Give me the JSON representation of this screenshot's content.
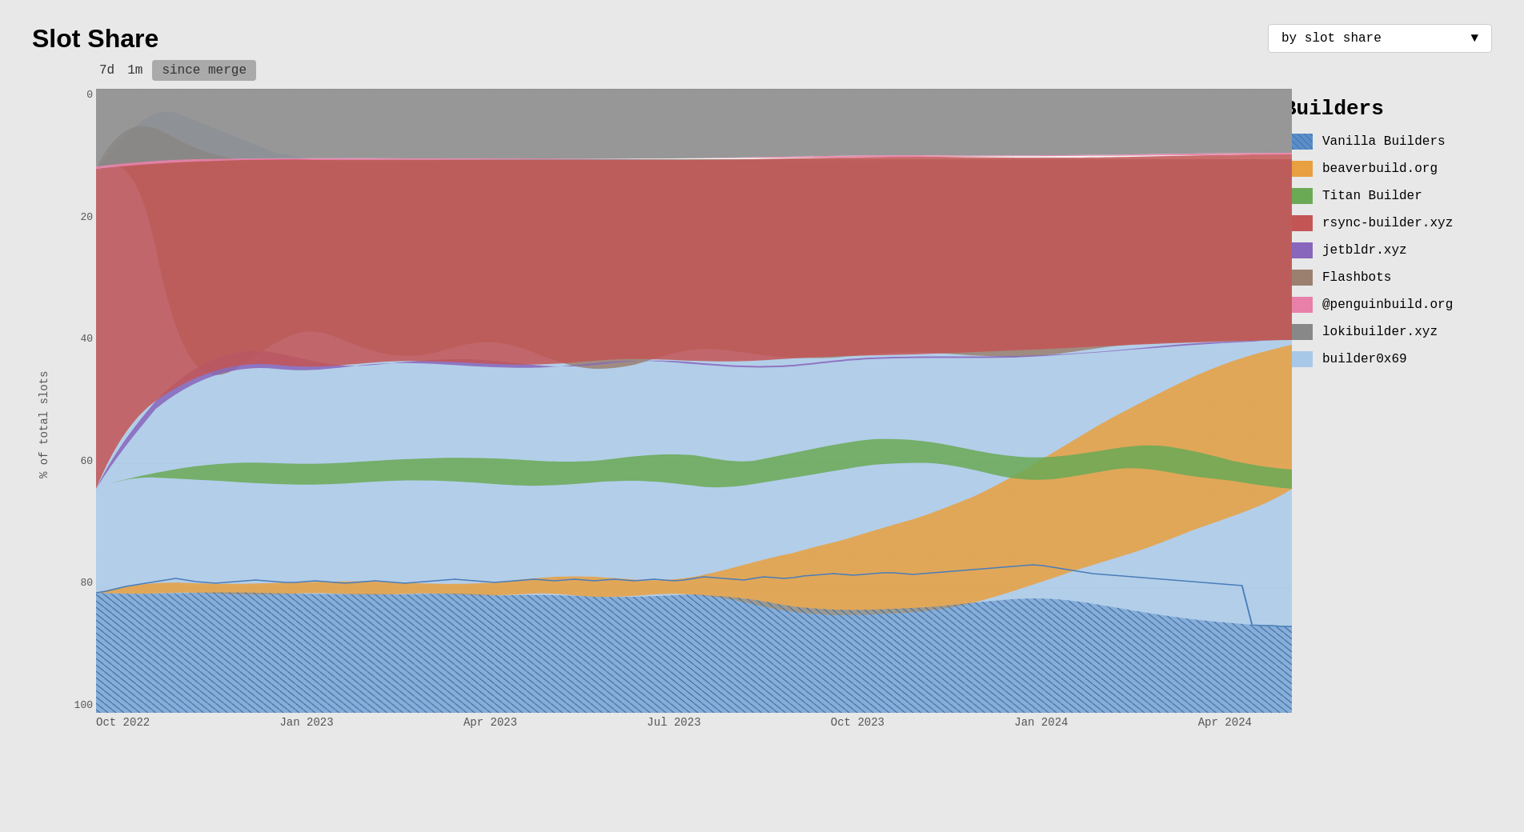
{
  "title": "Slot Share",
  "timeButtons": [
    {
      "label": "7d",
      "active": false
    },
    {
      "label": "1m",
      "active": false
    },
    {
      "label": "since merge",
      "active": true
    }
  ],
  "dropdown": {
    "label": "by slot share",
    "arrow": "▼"
  },
  "chart": {
    "yAxisLabel": "% of total slots",
    "yTicks": [
      "0",
      "20",
      "40",
      "60",
      "80",
      "100"
    ],
    "xTicks": [
      "Oct 2022",
      "Jan 2023",
      "Apr 2023",
      "Jul 2023",
      "Oct 2023",
      "Jan 2024",
      "Apr 2024"
    ]
  },
  "legend": {
    "title": "Builders",
    "items": [
      {
        "name": "Vanilla Builders",
        "color": "#5b8dc9"
      },
      {
        "name": "beaverbuild.org",
        "color": "#e8a040"
      },
      {
        "name": "Titan Builder",
        "color": "#6aaa55"
      },
      {
        "name": "rsync-builder.xyz",
        "color": "#c45555"
      },
      {
        "name": "jetbldr.xyz",
        "color": "#8866bb"
      },
      {
        "name": "Flashbots",
        "color": "#9b8070"
      },
      {
        "name": "@penguinbuild.org",
        "color": "#e880aa"
      },
      {
        "name": "lokibuilder.xyz",
        "color": "#888888"
      },
      {
        "name": "builder0x69",
        "color": "#a8c8e8"
      }
    ]
  }
}
